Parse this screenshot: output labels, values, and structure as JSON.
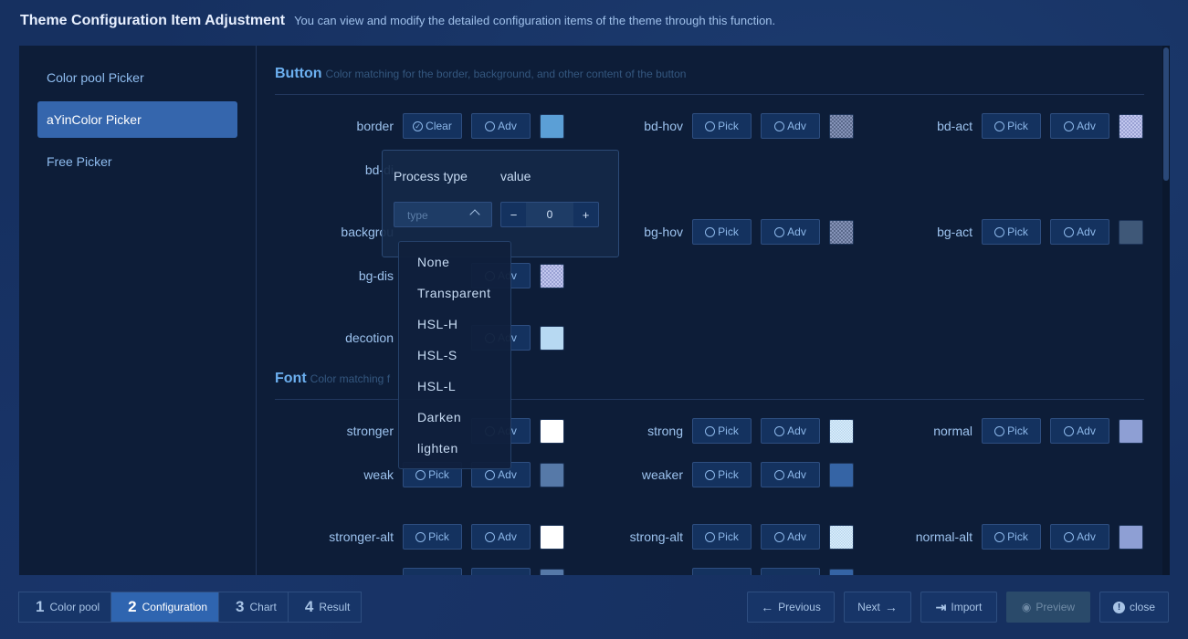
{
  "header": {
    "title": "Theme Configuration Item Adjustment",
    "desc": "You can view and modify the detailed configuration items of the theme through this function."
  },
  "sidebar": {
    "items": [
      {
        "label": "Color pool Picker"
      },
      {
        "label": "aYinColor Picker"
      },
      {
        "label": "Free Picker"
      }
    ]
  },
  "sections": {
    "button": {
      "title": "Button",
      "sub": "Color matching for the border, background, and other content of the button"
    },
    "font": {
      "title": "Font",
      "sub": "Color matching f"
    }
  },
  "labels": {
    "border": "border",
    "bd_hov": "bd-hov",
    "bd_act": "bd-act",
    "bd_dis": "bd-di",
    "background": "backgrou",
    "bg_hov": "bg-hov",
    "bg_act": "bg-act",
    "bg_dis": "bg-dis",
    "decotion": "decotion",
    "stronger": "stronger",
    "strong": "strong",
    "normal": "normal",
    "weak": "weak",
    "weaker": "weaker",
    "stronger_alt": "stronger-alt",
    "strong_alt": "strong-alt",
    "normal_alt": "normal-alt"
  },
  "buttons": {
    "pick": "Pick",
    "adv": "Adv",
    "clear": "Clear"
  },
  "popup": {
    "process_type": "Process type",
    "value": "value",
    "type_placeholder": "type",
    "stepper_value": "0",
    "minus": "−",
    "plus": "+"
  },
  "dropdown": {
    "options": [
      "None",
      "Transparent",
      "HSL-H",
      "HSL-S",
      "HSL-L",
      "Darken",
      "lighten"
    ]
  },
  "footer": {
    "steps": [
      {
        "num": "1",
        "label": "Color pool"
      },
      {
        "num": "2",
        "label": "Configuration"
      },
      {
        "num": "3",
        "label": "Chart"
      },
      {
        "num": "4",
        "label": "Result"
      }
    ],
    "previous": "Previous",
    "next": "Next",
    "import": "Import",
    "preview": "Preview",
    "close": "close"
  },
  "colors": {
    "border_swatch": "#5b9fd6",
    "bg_act_swatch": "#3f5878",
    "decotion_swatch": "#b7d9f2",
    "white": "#ffffff",
    "normal_swatch": "#8e9fd4",
    "weak_swatch": "#5679a8",
    "weaker_swatch": "#3564a5"
  }
}
